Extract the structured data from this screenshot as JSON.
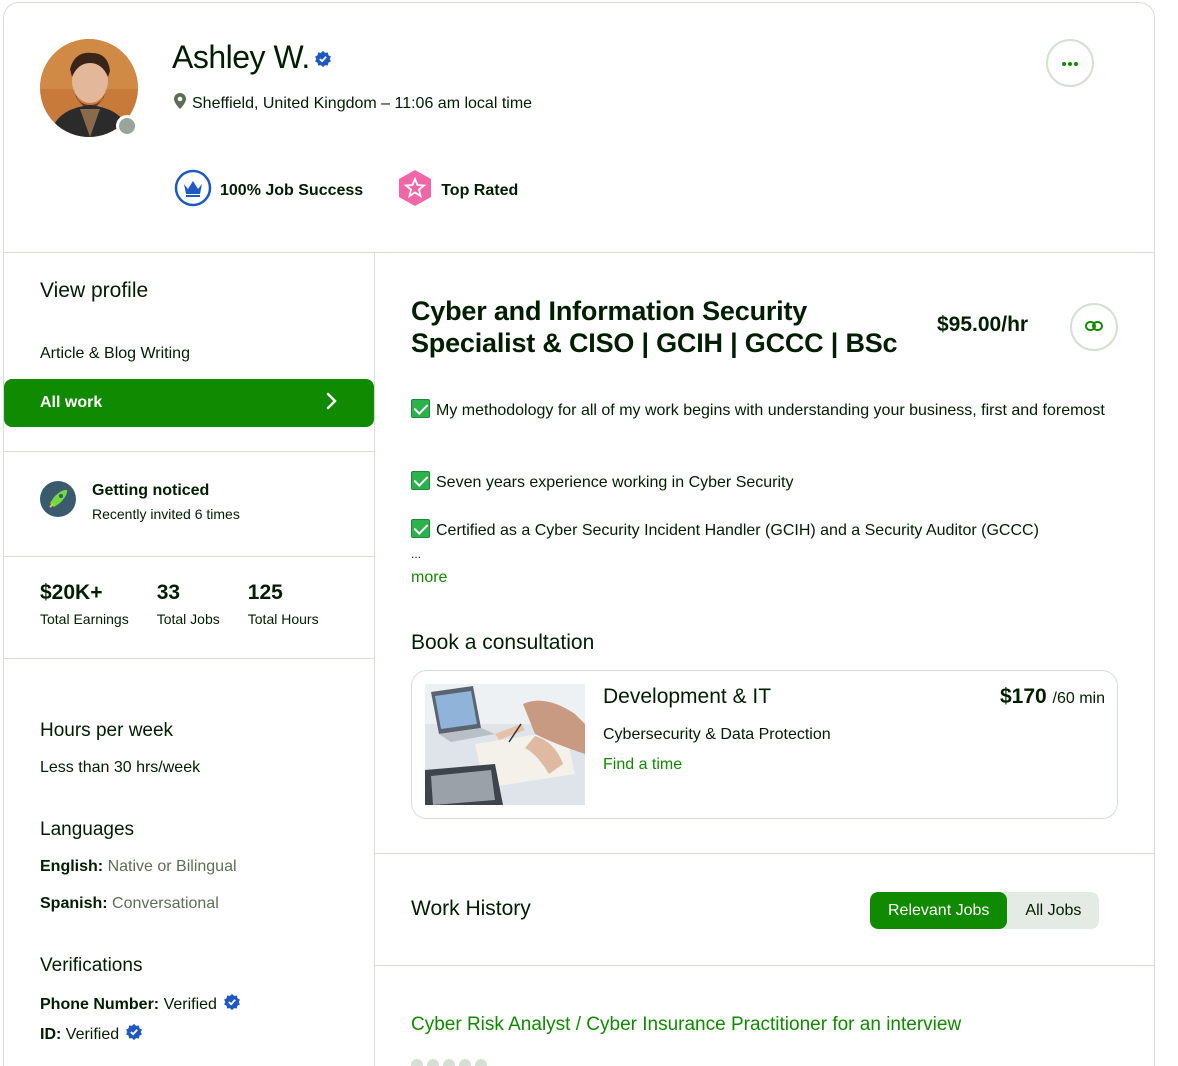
{
  "profile": {
    "name": "Ashley W.",
    "location": "Sheffield, United Kingdom – 11:06 am local time",
    "badges": {
      "job_success": "100% Job Success",
      "top_rated": "Top Rated"
    }
  },
  "sidebar": {
    "view_profile": "View profile",
    "specialized": "Article & Blog Writing",
    "all_work": "All work",
    "notice": {
      "title": "Getting noticed",
      "subtitle": "Recently invited 6 times"
    },
    "stats": [
      {
        "value": "$20K+",
        "label": "Total Earnings"
      },
      {
        "value": "33",
        "label": "Total Jobs"
      },
      {
        "value": "125",
        "label": "Total Hours"
      }
    ],
    "hours": {
      "title": "Hours per week",
      "value": "Less than 30 hrs/week"
    },
    "languages": {
      "title": "Languages",
      "items": [
        {
          "lang": "English:",
          "level": "Native or Bilingual"
        },
        {
          "lang": "Spanish:",
          "level": "Conversational"
        }
      ]
    },
    "verifications": {
      "title": "Verifications",
      "items": [
        {
          "label": "Phone Number:",
          "value": "Verified"
        },
        {
          "label": "ID:",
          "value": "Verified"
        }
      ]
    }
  },
  "main": {
    "title": "Cyber and Information Security Specialist & CISO | GCIH | GCCC | BSc",
    "rate": "$95.00/hr",
    "bullets": [
      "My methodology for all of my work begins with understanding your business, first and foremost",
      "Seven years experience working in Cyber Security",
      "Certified as a Cyber Security Incident Handler (GCIH) and a Security Auditor (GCCC)"
    ],
    "ellipsis": "...",
    "more_label": "more",
    "consultation": {
      "heading": "Book a consultation",
      "category": "Development & IT",
      "price": "$170",
      "duration": "/60 min",
      "subcategory": "Cybersecurity & Data Protection",
      "cta": "Find a time"
    },
    "work_history": {
      "title": "Work History",
      "tabs": [
        "Relevant Jobs",
        "All Jobs"
      ],
      "first_job": "Cyber Risk Analyst / Cyber Insurance Practitioner for an interview"
    }
  },
  "colors": {
    "brand_green": "#108a00",
    "verified_blue": "#1f57c3",
    "top_rated_pink": "#f066a6"
  },
  "icons": [
    "verified-badge-icon",
    "location-pin-icon",
    "more-dots-icon",
    "crown-icon",
    "star-badge-icon",
    "chevron-right-icon",
    "rocket-icon",
    "link-icon",
    "checkbox-icon"
  ]
}
